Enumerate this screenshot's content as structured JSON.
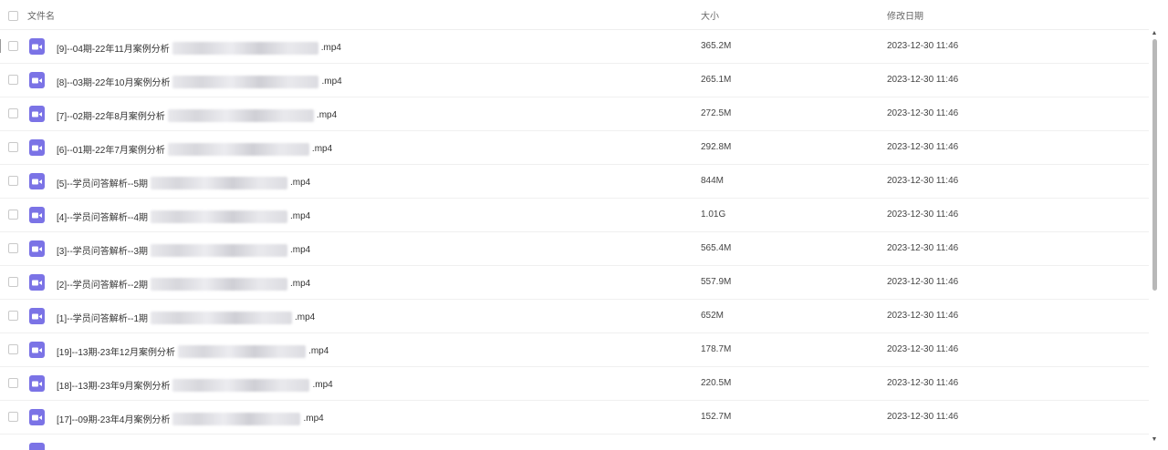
{
  "header": {
    "name_label": "文件名",
    "size_label": "大小",
    "date_label": "修改日期"
  },
  "files": [
    {
      "prefix": "[9]--04期-22年11月案例分析",
      "suffix": ".mp4",
      "size": "365.2M",
      "date": "2023-12-30 11:46"
    },
    {
      "prefix": "[8]--03期-22年10月案例分析",
      "suffix": ".mp4",
      "size": "265.1M",
      "date": "2023-12-30 11:46"
    },
    {
      "prefix": "[7]--02期-22年8月案例分析",
      "suffix": ".mp4",
      "size": "272.5M",
      "date": "2023-12-30 11:46"
    },
    {
      "prefix": "[6]--01期-22年7月案例分析",
      "suffix": ".mp4",
      "size": "292.8M",
      "date": "2023-12-30 11:46"
    },
    {
      "prefix": "[5]--学员问答解析--5期",
      "suffix": ".mp4",
      "size": "844M",
      "date": "2023-12-30 11:46"
    },
    {
      "prefix": "[4]--学员问答解析--4期",
      "suffix": ".mp4",
      "size": "1.01G",
      "date": "2023-12-30 11:46"
    },
    {
      "prefix": "[3]--学员问答解析--3期",
      "suffix": ".mp4",
      "size": "565.4M",
      "date": "2023-12-30 11:46"
    },
    {
      "prefix": "[2]--学员问答解析--2期",
      "suffix": ".mp4",
      "size": "557.9M",
      "date": "2023-12-30 11:46"
    },
    {
      "prefix": "[1]--学员问答解析--1期",
      "suffix": ".mp4",
      "size": "652M",
      "date": "2023-12-30 11:46"
    },
    {
      "prefix": "[19]--13期-23年12月案例分析",
      "suffix": ".mp4",
      "size": "178.7M",
      "date": "2023-12-30 11:46"
    },
    {
      "prefix": "[18]--13期-23年9月案例分析",
      "suffix": ".mp4",
      "size": "220.5M",
      "date": "2023-12-30 11:46"
    },
    {
      "prefix": "[17]--09期-23年4月案例分析",
      "suffix": ".mp4",
      "size": "152.7M",
      "date": "2023-12-30 11:46"
    }
  ],
  "icons": {
    "file_icon": "video-file-icon",
    "file_icon_color": "#7b73e6"
  }
}
